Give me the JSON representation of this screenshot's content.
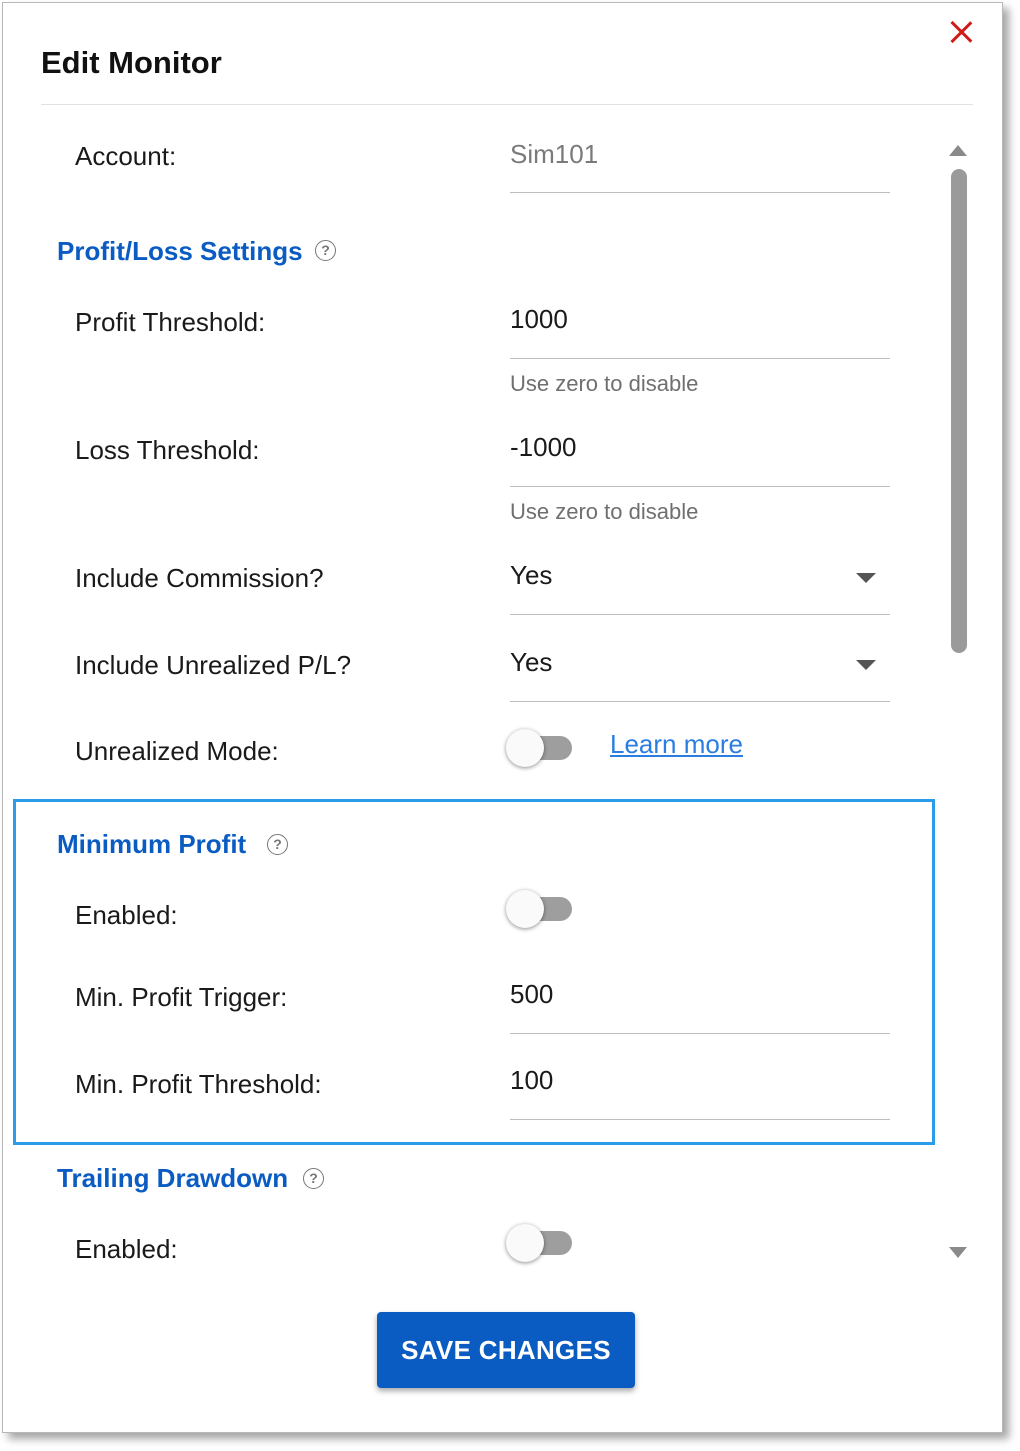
{
  "dialog": {
    "title": "Edit Monitor",
    "close_icon": "close-icon",
    "accent_color": "#0b5cc2",
    "close_color": "#d11a1a"
  },
  "account": {
    "label": "Account:",
    "value": "Sim101"
  },
  "profit_loss": {
    "heading": "Profit/Loss Settings",
    "help_glyph": "?",
    "profit_threshold": {
      "label": "Profit Threshold:",
      "value": "1000",
      "hint": "Use zero to disable"
    },
    "loss_threshold": {
      "label": "Loss Threshold:",
      "value": "-1000",
      "hint": "Use zero to disable"
    },
    "include_commission": {
      "label": "Include Commission?",
      "value": "Yes"
    },
    "include_unrealized": {
      "label": "Include Unrealized P/L?",
      "value": "Yes"
    },
    "unrealized_mode": {
      "label": "Unrealized Mode:",
      "enabled": false,
      "link": "Learn more"
    }
  },
  "minimum_profit": {
    "heading": "Minimum Profit",
    "help_glyph": "?",
    "enabled": {
      "label": "Enabled:",
      "on": false
    },
    "trigger": {
      "label": "Min. Profit Trigger:",
      "value": "500"
    },
    "threshold": {
      "label": "Min. Profit Threshold:",
      "value": "100"
    },
    "highlight_color": "#2a9ce8"
  },
  "trailing_drawdown": {
    "heading": "Trailing Drawdown",
    "help_glyph": "?",
    "enabled": {
      "label": "Enabled:",
      "on": false
    }
  },
  "footer": {
    "save_label": "SAVE CHANGES"
  }
}
